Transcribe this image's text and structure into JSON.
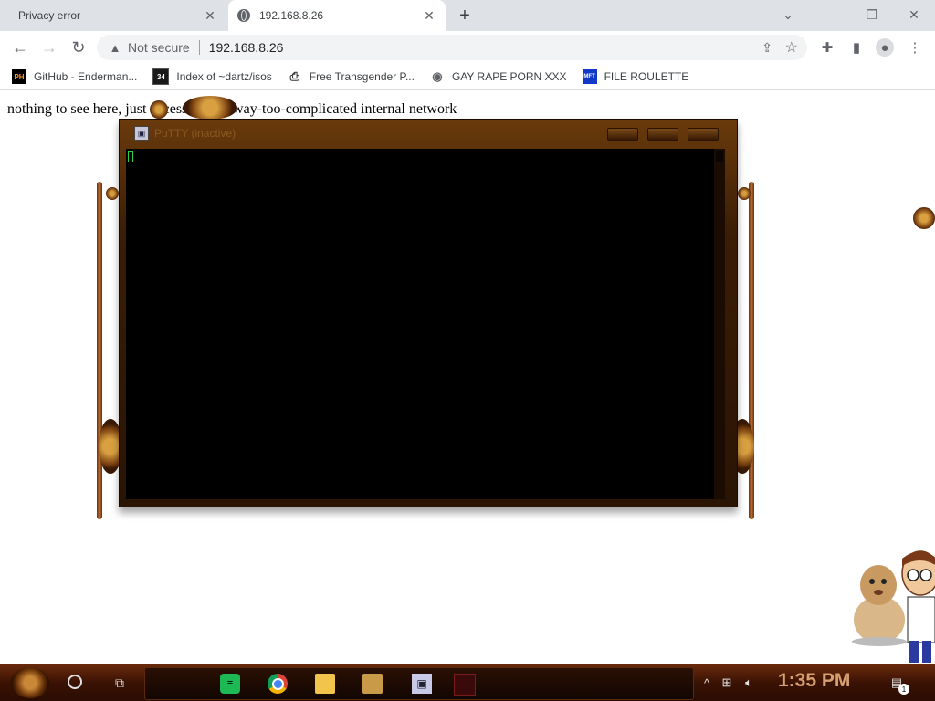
{
  "browser": {
    "tabs": [
      {
        "title": "Privacy error",
        "active": false
      },
      {
        "title": "192.168.8.26",
        "active": true
      }
    ],
    "new_tab_symbol": "+",
    "address": {
      "security_label": "Not secure",
      "url": "192.168.8.26"
    },
    "bookmarks": [
      {
        "label": "GitHub - Enderman...",
        "icon": "ph-favicon",
        "icon_text": "PH"
      },
      {
        "label": "Index of ~dartz/isos",
        "icon": "34-favicon",
        "icon_text": "34"
      },
      {
        "label": "Free Transgender P...",
        "icon": "printer-favicon",
        "icon_text": ""
      },
      {
        "label": "GAY RAPE PORN XXX",
        "icon": "globe-favicon",
        "icon_text": ""
      },
      {
        "label": "FILE ROULETTE",
        "icon": "mft-favicon",
        "icon_text": "MFT"
      }
    ]
  },
  "page": {
    "text": "nothing to see here, just accessing our way-too-complicated internal network"
  },
  "putty": {
    "title": "PuTTY (inactive)"
  },
  "taskbar": {
    "clock": "1:35 PM",
    "notification_count": "1",
    "apps": [
      "spotify-icon",
      "chrome-icon",
      "file-explorer-icon",
      "game-icon",
      "putty-icon",
      "red-app-icon"
    ]
  },
  "colors": {
    "tabstrip": "#dee1e6",
    "terminal_bg": "#000000",
    "cursor": "#2fd04a",
    "taskbar_accent": "#6a2a0c"
  }
}
